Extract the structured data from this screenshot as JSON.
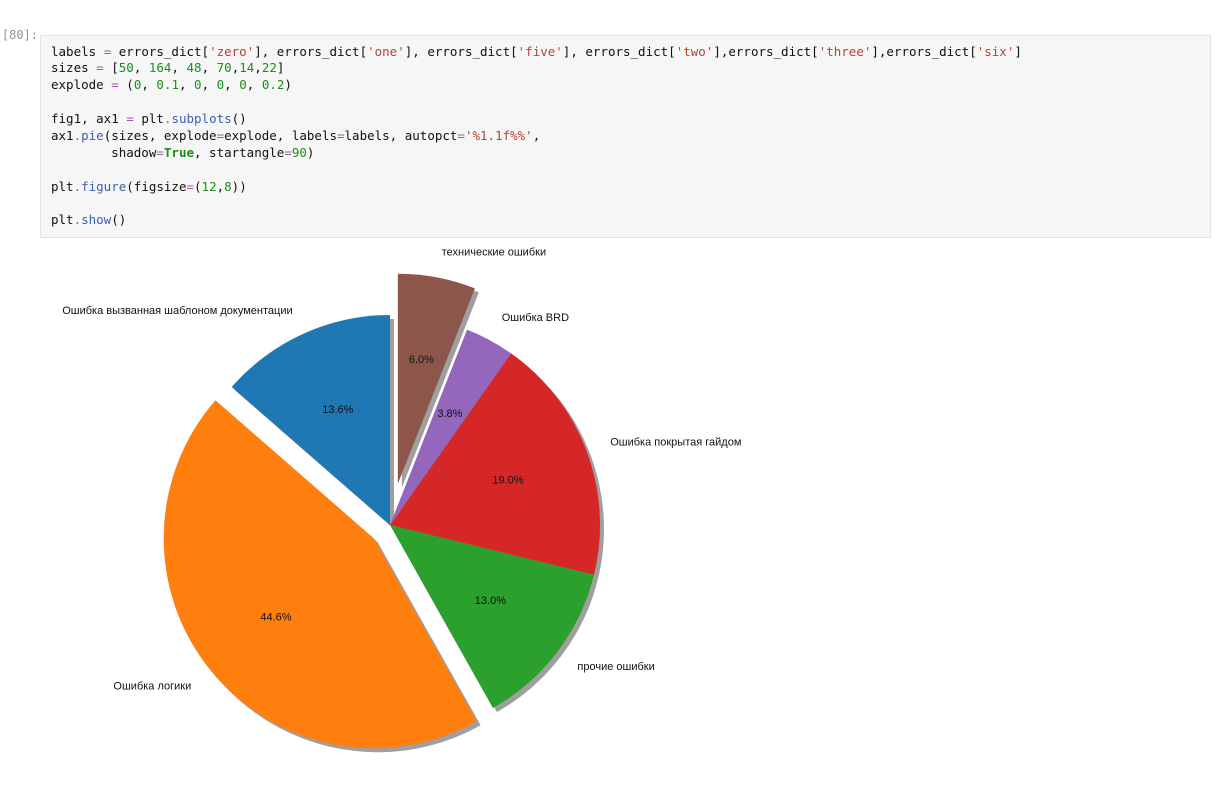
{
  "prompt_label": "[80]:",
  "code_lines": [
    "labels = errors_dict['zero'], errors_dict['one'], errors_dict['five'], errors_dict['two'],errors_dict['three'],errors_dict['six']",
    "sizes = [50, 164, 48, 70,14,22]",
    "explode = (0, 0.1, 0, 0, 0, 0.2)",
    "",
    "fig1, ax1 = plt.subplots()",
    "ax1.pie(sizes, explode=explode, labels=labels, autopct='%1.1f%%',",
    "        shadow=True, startangle=90)",
    "",
    "plt.figure(figsize=(12,8))",
    "",
    "plt.show()"
  ],
  "chart_data": {
    "type": "pie",
    "startangle": 90,
    "autopct": "%1.1f%%",
    "shadow": true,
    "slices": [
      {
        "label": "Ошибка вызванная шаблоном документации",
        "value": 50,
        "pct": "13.6%",
        "color": "#1f77b4",
        "explode": 0
      },
      {
        "label": "Ошибка логики",
        "value": 164,
        "pct": "44.6%",
        "color": "#ff7f0e",
        "explode": 0.1
      },
      {
        "label": "прочие ошибки",
        "value": 48,
        "pct": "13.0%",
        "color": "#2ca02c",
        "explode": 0
      },
      {
        "label": "Ошибка покрытая гайдом",
        "value": 70,
        "pct": "19.0%",
        "color": "#d62728",
        "explode": 0
      },
      {
        "label": "Ошибка BRD",
        "value": 14,
        "pct": "3.8%",
        "color": "#9467bd",
        "explode": 0
      },
      {
        "label": "технические ошибки",
        "value": 22,
        "pct": "6.0%",
        "color": "#8c564b",
        "explode": 0.2
      }
    ]
  }
}
